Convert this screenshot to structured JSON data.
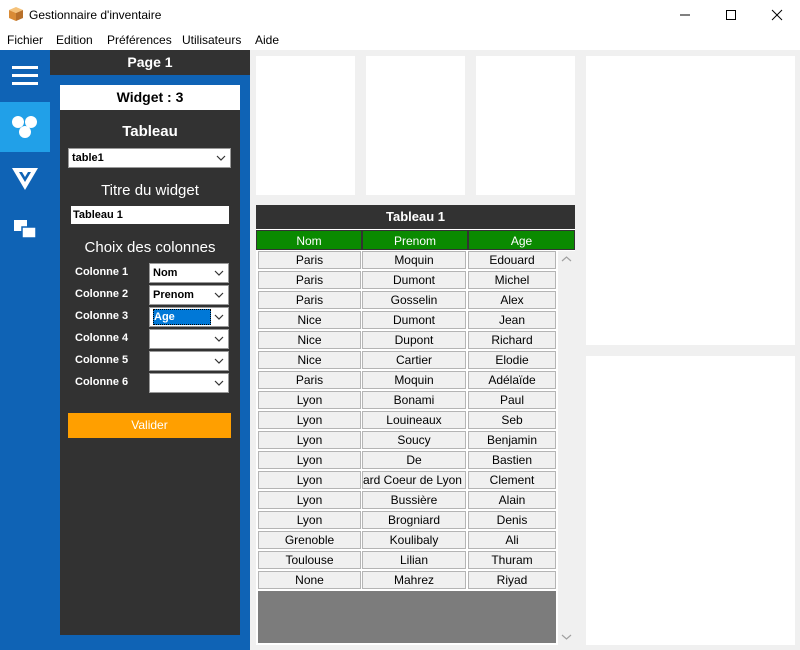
{
  "window": {
    "title": "Gestionnaire d'inventaire",
    "minimize": "—",
    "maximize": "☐",
    "close": "✕"
  },
  "menu": [
    "Fichier",
    "Edition",
    "Préférences",
    "Utilisateurs",
    "Aide"
  ],
  "sidebar_icons": [
    "hamburger-icon",
    "widgets-icon",
    "filter-icon",
    "windows-icon"
  ],
  "page_header": "Page 1",
  "config": {
    "widget_label": "Widget : 3",
    "table_heading": "Tableau",
    "table_select": "table1",
    "title_heading": "Titre du widget",
    "title_value": "Tableau 1",
    "columns_heading": "Choix des colonnes",
    "columns": [
      {
        "label": "Colonne 1",
        "value": "Nom"
      },
      {
        "label": "Colonne 2",
        "value": "Prenom"
      },
      {
        "label": "Colonne 3",
        "value": "Age"
      },
      {
        "label": "Colonne 4",
        "value": ""
      },
      {
        "label": "Colonne 5",
        "value": ""
      },
      {
        "label": "Colonne 6",
        "value": ""
      }
    ],
    "validate_label": "Valider"
  },
  "table": {
    "title": "Tableau 1",
    "headers": [
      "Nom",
      "Prenom",
      "Age"
    ],
    "rows": [
      [
        "Paris",
        "Moquin",
        "Edouard"
      ],
      [
        "Paris",
        "Dumont",
        "Michel"
      ],
      [
        "Paris",
        "Gosselin",
        "Alex"
      ],
      [
        "Nice",
        "Dumont",
        "Jean"
      ],
      [
        "Nice",
        "Dupont",
        "Richard"
      ],
      [
        "Nice",
        "Cartier",
        "Elodie"
      ],
      [
        "Paris",
        "Moquin",
        "Adélaïde"
      ],
      [
        "Lyon",
        "Bonami",
        "Paul"
      ],
      [
        "Lyon",
        "Louineaux",
        "Seb"
      ],
      [
        "Lyon",
        "Soucy",
        "Benjamin"
      ],
      [
        "Lyon",
        "De",
        "Bastien"
      ],
      [
        "Lyon",
        "ard Coeur de Lyon e",
        "Clement"
      ],
      [
        "Lyon",
        "Bussière",
        "Alain"
      ],
      [
        "Lyon",
        "Brogniard",
        "Denis"
      ],
      [
        "Grenoble",
        "Koulibaly",
        "Ali"
      ],
      [
        "Toulouse",
        "Lilian",
        "Thuram"
      ],
      [
        "None",
        "Mahrez",
        "Riyad"
      ]
    ]
  },
  "colors": {
    "sidebar": "#0f63b5",
    "panel": "#323232",
    "header_green": "#0a8a00",
    "accent": "#ff9f00",
    "selected": "#21a0e8"
  }
}
